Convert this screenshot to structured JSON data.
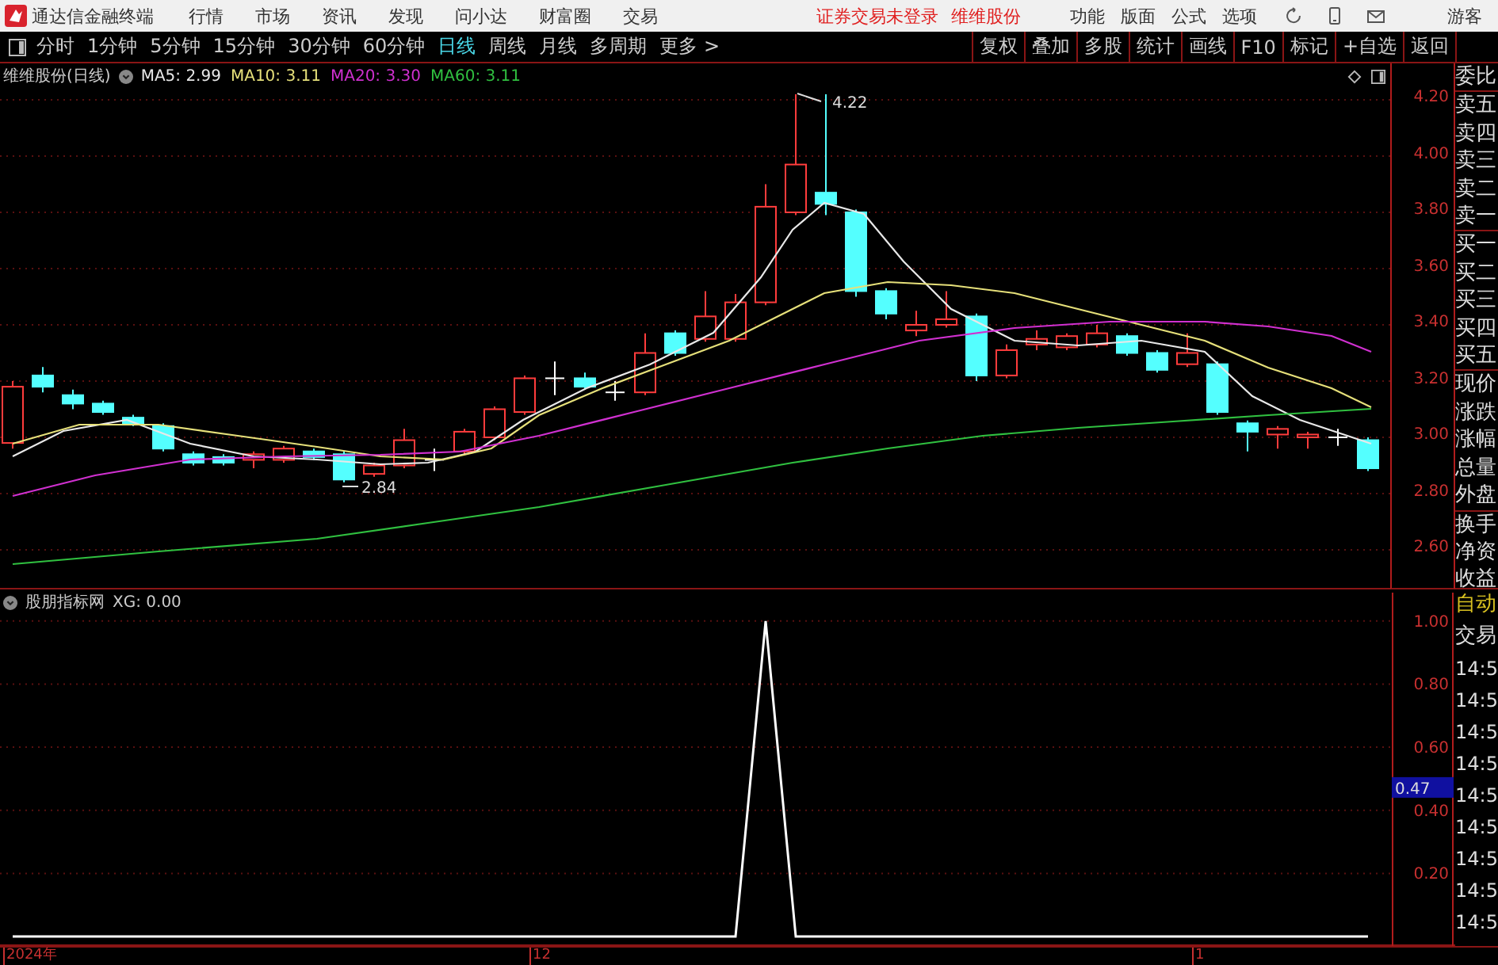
{
  "app_title": "通达信金融终端",
  "menu": [
    "行情",
    "市场",
    "资讯",
    "发现",
    "问小达",
    "财富圈",
    "交易"
  ],
  "login_status": "证券交易未登录",
  "stock_link": "维维股份",
  "right_menu": [
    "功能",
    "版面",
    "公式",
    "选项"
  ],
  "user": "游客",
  "periods": [
    {
      "label": "分时",
      "selected": false
    },
    {
      "label": "1分钟",
      "selected": false
    },
    {
      "label": "5分钟",
      "selected": false
    },
    {
      "label": "15分钟",
      "selected": false
    },
    {
      "label": "30分钟",
      "selected": false
    },
    {
      "label": "60分钟",
      "selected": false
    },
    {
      "label": "日线",
      "selected": true
    },
    {
      "label": "周线",
      "selected": false
    },
    {
      "label": "月线",
      "selected": false
    },
    {
      "label": "多周期",
      "selected": false
    },
    {
      "label": "更多 >",
      "selected": false
    }
  ],
  "tools": [
    "复权",
    "叠加",
    "多股",
    "统计",
    "画线",
    "F10",
    "标记",
    "+自选",
    "返回"
  ],
  "main_chart": {
    "title": "维维股份(日线)",
    "ma_legend": [
      {
        "label": "MA5: 2.99",
        "color": "#e8e8e8"
      },
      {
        "label": "MA10: 3.11",
        "color": "#e6e07a"
      },
      {
        "label": "MA20: 3.30",
        "color": "#d030d0"
      },
      {
        "label": "MA60: 3.11",
        "color": "#30c040"
      }
    ],
    "high_label": "4.22",
    "low_label": "2.84",
    "price_axis": [
      "4.20",
      "4.00",
      "3.80",
      "3.60",
      "3.40",
      "3.20",
      "3.00",
      "2.80",
      "2.60"
    ]
  },
  "indicator": {
    "name": "股朋指标网",
    "reading": "XG: 0.00",
    "cursor_value": "0.47",
    "chart_data": {
      "type": "line",
      "grid": true,
      "ylim": [
        -0.03,
        1.1
      ],
      "yticks": [
        {
          "value": 0.2,
          "label": "0.20"
        },
        {
          "value": 0.4,
          "label": "0.40"
        },
        {
          "value": 0.6,
          "label": "0.60"
        },
        {
          "value": 0.8,
          "label": "0.80"
        },
        {
          "value": 1,
          "label": "1.00"
        }
      ],
      "series": [
        {
          "color": "#ffffff",
          "values": [
            0,
            0,
            0,
            0,
            0,
            0,
            0,
            0,
            0,
            0,
            0,
            0,
            0,
            0,
            0,
            0,
            0,
            0,
            0,
            0,
            0,
            0,
            0,
            0,
            0,
            1,
            0,
            0,
            0,
            0,
            0,
            0,
            0,
            0,
            0,
            0,
            0,
            0,
            0,
            0,
            0,
            0,
            0,
            0,
            0,
            0
          ]
        }
      ]
    }
  },
  "quote_groups": [
    {
      "labels": [
        "委比"
      ]
    },
    {
      "labels": [
        "卖五",
        "卖四",
        "卖三",
        "卖二",
        "卖一"
      ]
    },
    {
      "labels": [
        "买一",
        "买二",
        "买三",
        "买四",
        "买五"
      ]
    },
    {
      "labels": [
        "现价",
        "涨跌",
        "涨幅",
        "总量",
        "外盘"
      ]
    },
    {
      "labels": [
        "换手",
        "净资",
        "收益"
      ]
    }
  ],
  "trade_panel": [
    {
      "kind": "toggle",
      "label": "自动"
    },
    {
      "kind": "header",
      "label": "交易"
    },
    {
      "kind": "time",
      "label": "14:5"
    },
    {
      "kind": "time",
      "label": "14:5"
    },
    {
      "kind": "time",
      "label": "14:5"
    },
    {
      "kind": "time",
      "label": "14:5"
    },
    {
      "kind": "time",
      "label": "14:5"
    },
    {
      "kind": "time",
      "label": "14:5"
    },
    {
      "kind": "time",
      "label": "14:5"
    },
    {
      "kind": "time",
      "label": "14:5"
    },
    {
      "kind": "time",
      "label": "14:5"
    }
  ],
  "date_axis": [
    "2024年",
    "12",
    "1"
  ]
}
